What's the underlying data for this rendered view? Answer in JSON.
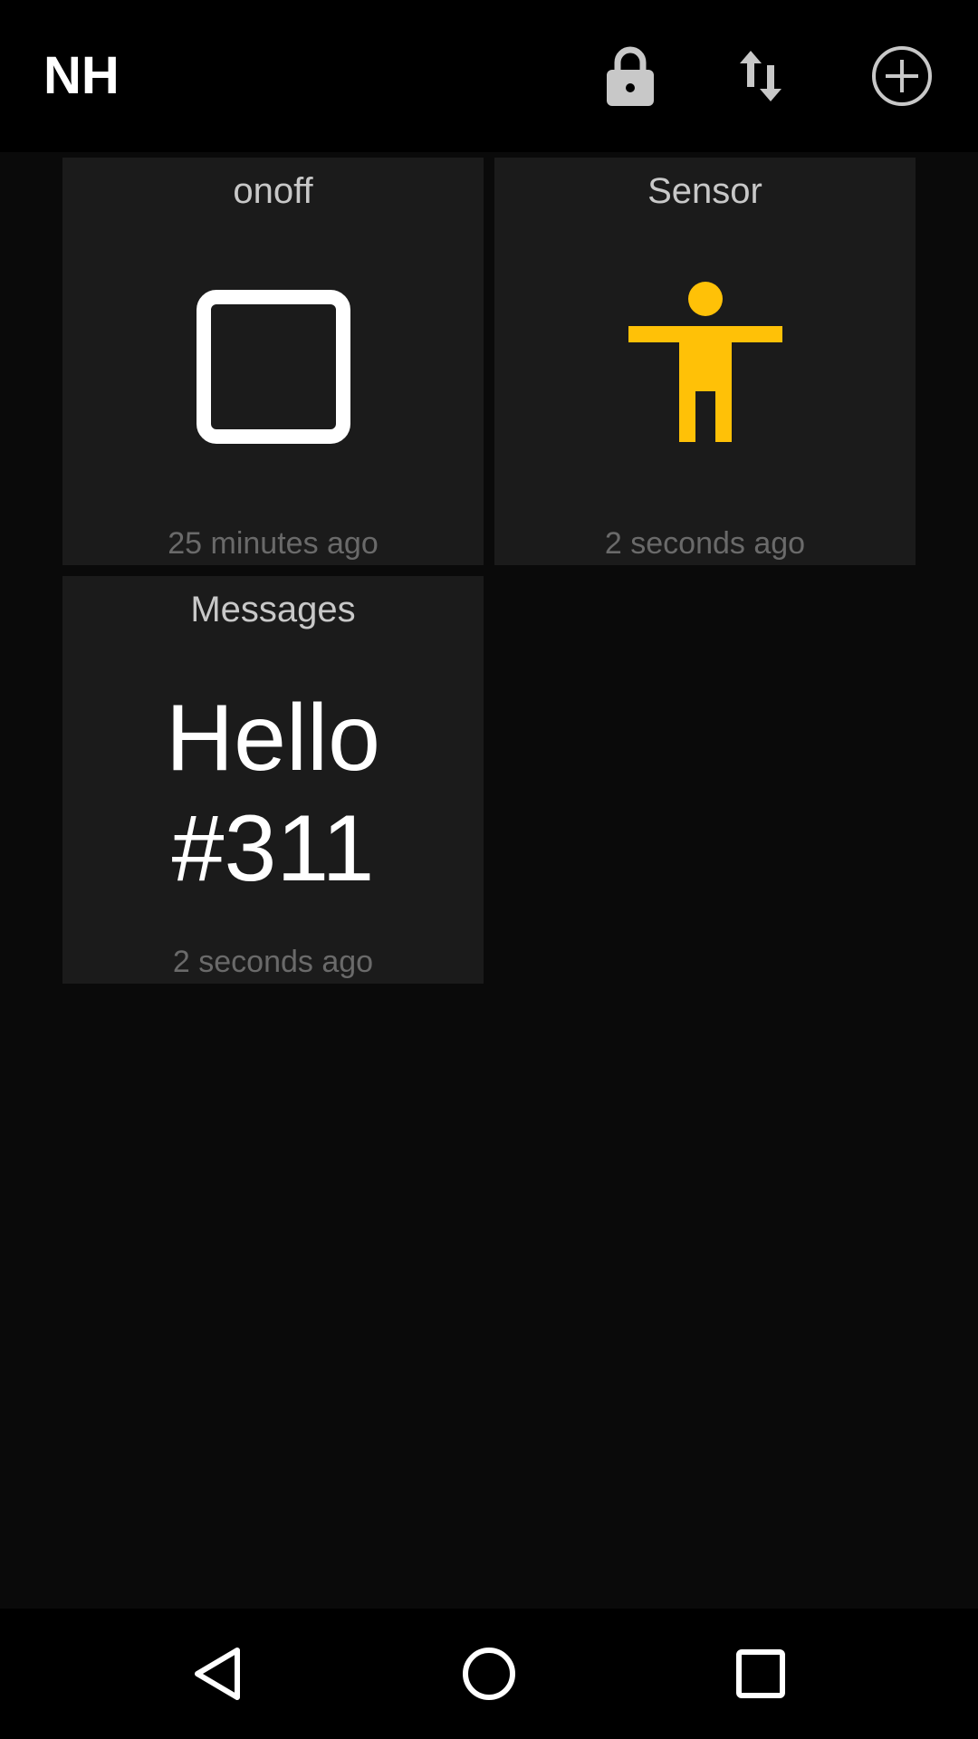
{
  "app_bar": {
    "title": "NH",
    "actions": [
      {
        "name": "lock-icon",
        "label": ""
      },
      {
        "name": "swap-vert-icon",
        "label": ""
      },
      {
        "name": "add-circle-icon",
        "label": ""
      }
    ]
  },
  "tiles": [
    {
      "title": "onoff",
      "icon": "square-outline-icon",
      "updated": "25 minutes ago"
    },
    {
      "title": "Sensor",
      "icon": "person-accessibility-icon",
      "icon_color": "#FFC107",
      "updated": "2 seconds ago"
    },
    {
      "title": "Messages",
      "message": "Hello\n#311",
      "updated": "2 seconds ago"
    }
  ],
  "nav_bar": {
    "buttons": [
      "back-icon",
      "home-icon",
      "recents-icon"
    ]
  },
  "colors": {
    "background": "#0a0a0a",
    "bar": "#000000",
    "tile": "#1b1b1b",
    "accent": "#FFC107"
  }
}
